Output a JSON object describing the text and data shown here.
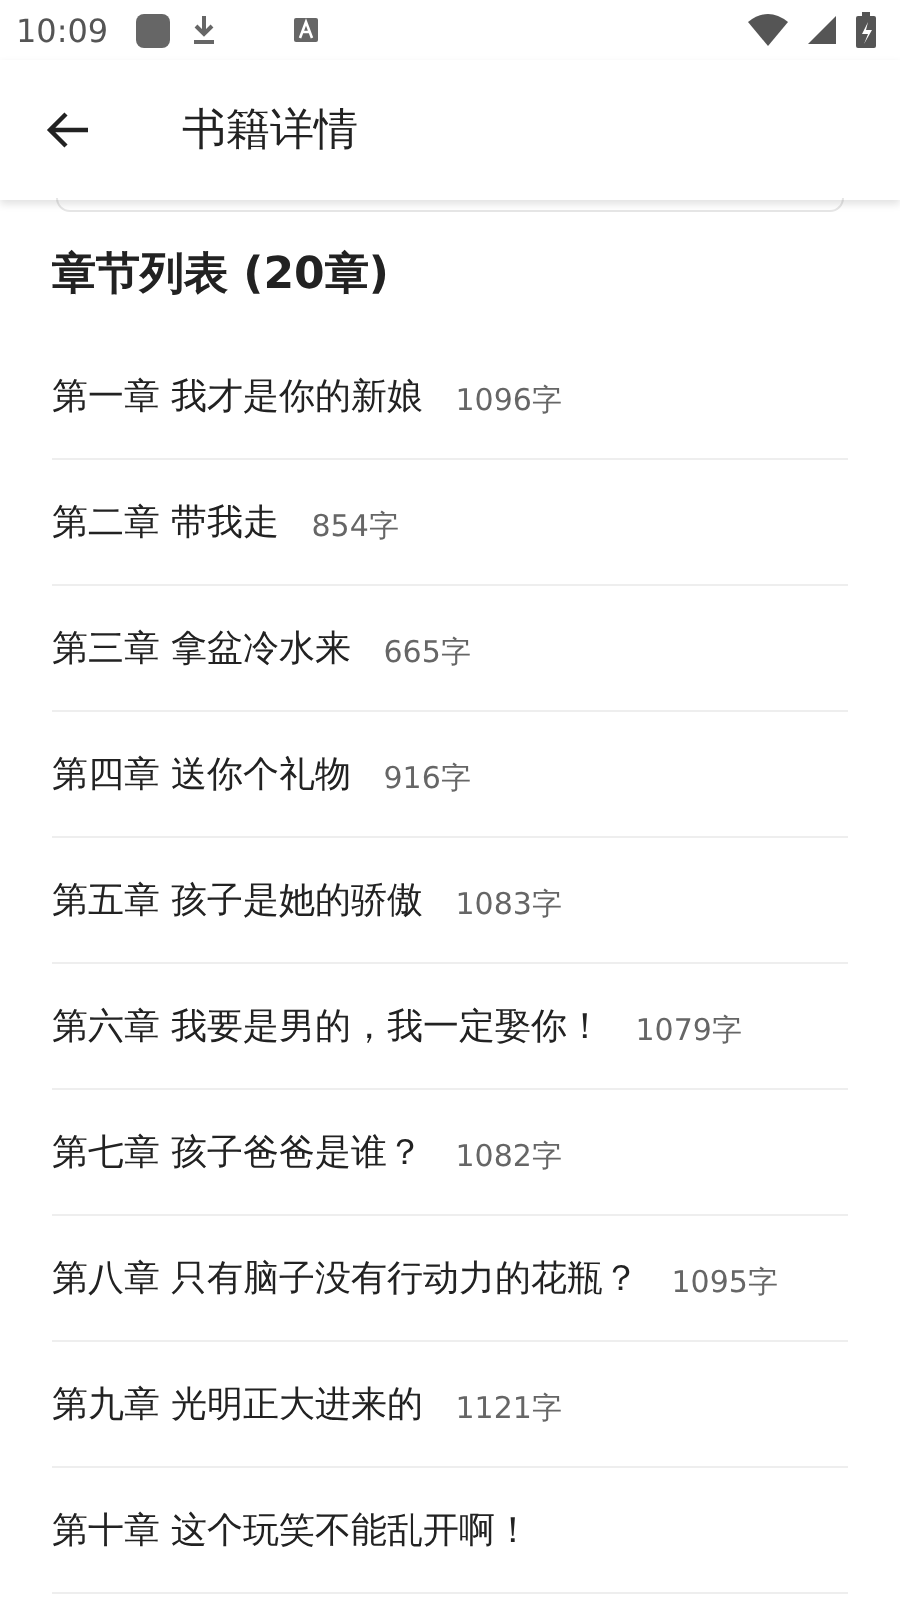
{
  "status_bar": {
    "time": "10:09"
  },
  "app_bar": {
    "title": "书籍详情"
  },
  "chapter_list": {
    "heading": "章节列表 (20章)",
    "chapters": [
      {
        "title": "第一章 我才是你的新娘",
        "count": "1096字"
      },
      {
        "title": "第二章 带我走",
        "count": "854字"
      },
      {
        "title": "第三章 拿盆冷水来",
        "count": "665字"
      },
      {
        "title": "第四章 送你个礼物",
        "count": "916字"
      },
      {
        "title": "第五章 孩子是她的骄傲",
        "count": "1083字"
      },
      {
        "title": "第六章 我要是男的，我一定娶你！",
        "count": "1079字"
      },
      {
        "title": "第七章 孩子爸爸是谁？",
        "count": "1082字"
      },
      {
        "title": "第八章 只有脑子没有行动力的花瓶？",
        "count": "1095字"
      },
      {
        "title": "第九章 光明正大进来的",
        "count": "1121字"
      },
      {
        "title": "第十章 这个玩笑不能乱开啊！"
      }
    ]
  }
}
